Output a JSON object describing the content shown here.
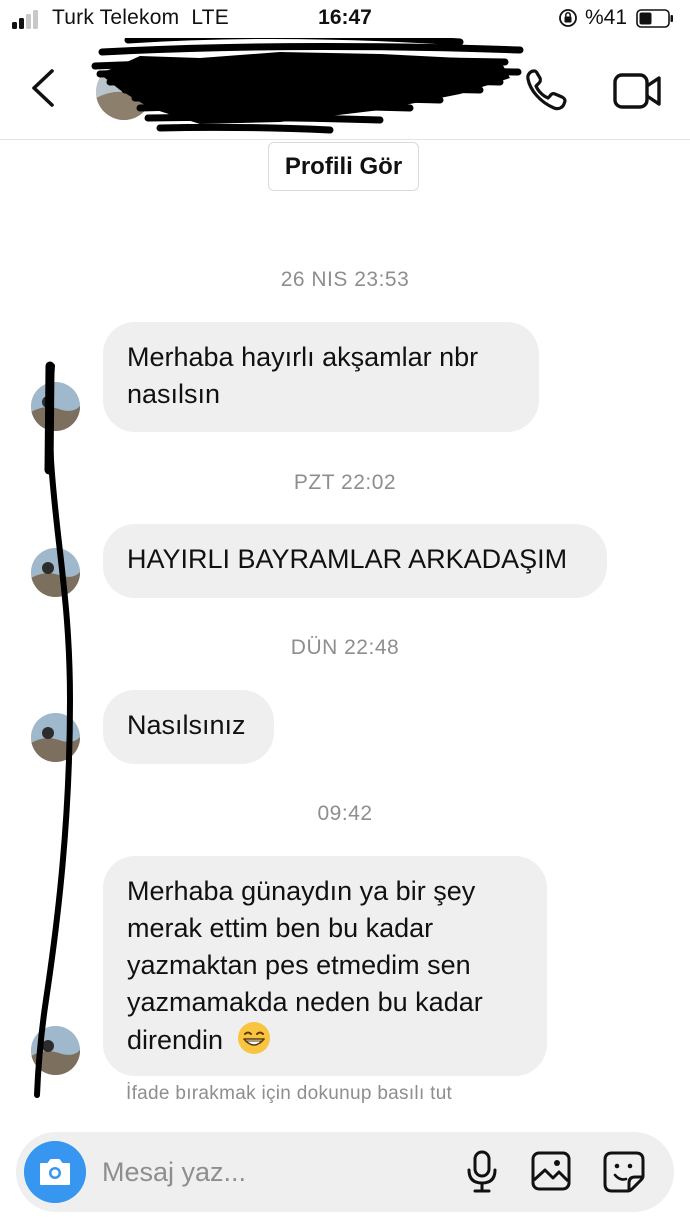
{
  "status_bar": {
    "carrier": "Turk Telekom",
    "network": "LTE",
    "time": "16:47",
    "battery": "%41"
  },
  "header": {
    "contact_name": "████████████",
    "contact_sub": "████████"
  },
  "icons": {
    "back": "chevron-left-icon",
    "call": "phone-icon",
    "video": "video-camera-icon",
    "camera": "camera-icon",
    "mic": "microphone-icon",
    "gallery": "image-icon",
    "sticker": "sticker-icon",
    "emoji": "grinning-face-emoji"
  },
  "chat": {
    "profile_button": "Profili Gör",
    "groups": [
      {
        "timestamp": "26 NIS 23:53",
        "message": "Merhaba hayırlı akşamlar nbr nasılsın"
      },
      {
        "timestamp": "PZT 22:02",
        "message": "HAYIRLI BAYRAMLAR ARKADAŞIM"
      },
      {
        "timestamp": "DÜN 22:48",
        "message": "Nasılsınız"
      },
      {
        "timestamp": "09:42",
        "message": "Merhaba günaydın ya bir şey merak ettim ben bu kadar yazmaktan pes etmedim sen yazmamakda neden bu kadar direndin",
        "emoji": "😄"
      }
    ],
    "reaction_hint": "İfade bırakmak için dokunup basılı tut"
  },
  "composer": {
    "placeholder": "Mesaj yaz..."
  },
  "colors": {
    "bubble": "#efefef",
    "accent_blue": "#3797f0",
    "meta_text": "#8e8e8e",
    "redaction_ink": "#000000"
  }
}
